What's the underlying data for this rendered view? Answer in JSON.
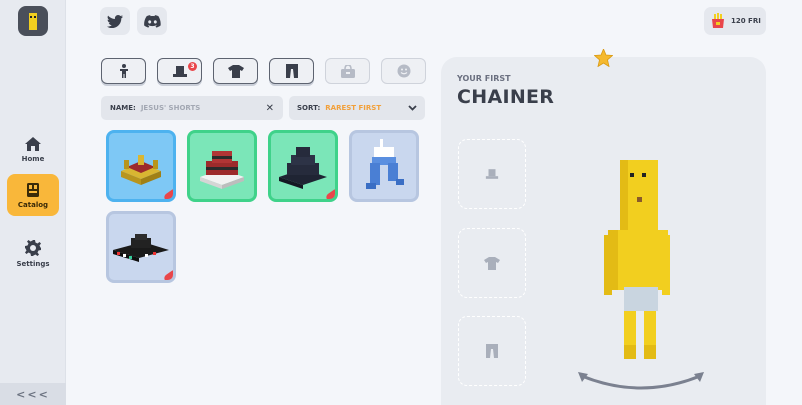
{
  "sidebar": {
    "items": [
      {
        "label": "Home",
        "icon": "home-icon"
      },
      {
        "label": "Catalog",
        "icon": "catalog-icon",
        "active": true
      },
      {
        "label": "Settings",
        "icon": "gear-icon"
      }
    ],
    "collapse": "<<<"
  },
  "topbar": {
    "social": [
      "twitter-icon",
      "discord-icon"
    ],
    "currency": "120 FRI"
  },
  "categories": [
    {
      "icon": "body-icon",
      "badge": ""
    },
    {
      "icon": "hat-icon",
      "badge": "3"
    },
    {
      "icon": "shirt-icon",
      "badge": ""
    },
    {
      "icon": "pants-icon",
      "badge": ""
    },
    {
      "icon": "bag-icon",
      "badge": "",
      "disabled": true
    },
    {
      "icon": "face-icon",
      "badge": "",
      "disabled": true
    }
  ],
  "filter": {
    "name_label": "NAME:",
    "name_value": "JESUS' SHORTS",
    "clear": "✕",
    "sort_label": "SORT:",
    "sort_value": "RAREST FIRST"
  },
  "items": [
    {
      "name": "item-crown-hat",
      "bg": "#7ec8f5",
      "border": "#4db2ef"
    },
    {
      "name": "item-red-tier-hat",
      "bg": "#7be6b8",
      "border": "#3fd28a"
    },
    {
      "name": "item-black-tier-hat",
      "bg": "#7be6b8",
      "border": "#3fd28a"
    },
    {
      "name": "item-blue-pants",
      "bg": "#c9d7ee",
      "border": "#b7c6e0"
    },
    {
      "name": "item-striped-cap",
      "bg": "#c9d7ee",
      "border": "#b7c6e0"
    }
  ],
  "preview": {
    "subtitle": "YOUR FIRST",
    "title": "CHAINER",
    "slots": [
      "hat-icon",
      "shirt-icon",
      "pants-icon"
    ]
  },
  "colors": {
    "accent": "#f9b73a",
    "character": "#f2cf1f"
  }
}
